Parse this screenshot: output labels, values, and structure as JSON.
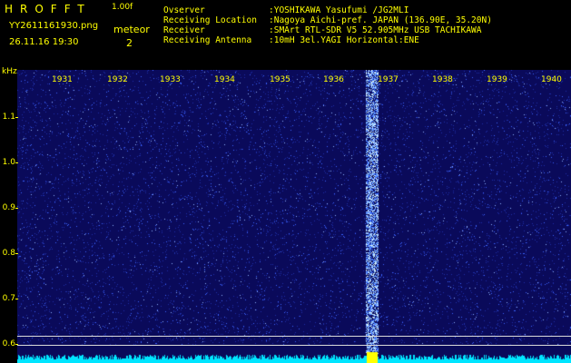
{
  "header": {
    "title": "HROFFT",
    "version": "1.00f",
    "filename": "YY2611161930.png",
    "datetime": "26.11.16 19:30",
    "meteor_label": "meteor",
    "meteor_count": "2"
  },
  "info": [
    {
      "label": "Ovserver",
      "value": ":YOSHIKAWA Yasufumi /JG2MLI"
    },
    {
      "label": "Receiving Location",
      "value": ":Nagoya Aichi-pref. JAPAN (136.90E, 35.20N)"
    },
    {
      "label": "Receiver",
      "value": ":SMArt RTL-SDR V5 52.905MHz USB TACHIKAWA"
    },
    {
      "label": "Receiving Antenna",
      "value": ":10mH 3el.YAGI Horizontal:ENE"
    }
  ],
  "axis": {
    "unit": "kHz",
    "y_labels": [
      "1.1",
      "1.0",
      "0.9",
      "0.8",
      "0.7",
      "0.6"
    ],
    "x_labels": [
      "1931",
      "1932",
      "1933",
      "1934",
      "1935",
      "1936",
      "1937",
      "1938",
      "1939",
      "1940"
    ]
  },
  "colors": {
    "text": "#ffff00",
    "background": "#0a0a5a",
    "noise": "#3c64ff",
    "meteor": "#a0e0ff",
    "baseline": "#00e5ff",
    "marker": "#ffff00"
  }
}
